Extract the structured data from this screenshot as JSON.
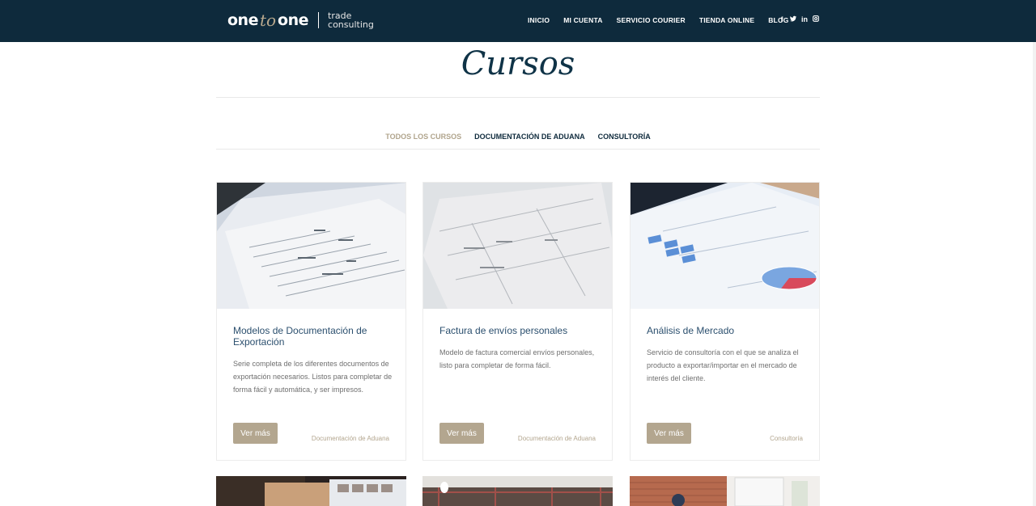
{
  "header": {
    "logo": {
      "one_left": "one",
      "to": "to",
      "one_right": "one",
      "sub_line1": "trade",
      "sub_line2": "consulting"
    },
    "nav": [
      "INICIO",
      "MI CUENTA",
      "SERVICIO COURIER",
      "TIENDA ONLINE",
      "BLOG"
    ],
    "social_icons": [
      {
        "name": "facebook-icon",
        "glyph": "f"
      },
      {
        "name": "twitter-icon",
        "glyph": "🐦"
      },
      {
        "name": "linkedin-icon",
        "glyph": "in"
      },
      {
        "name": "instagram-icon",
        "glyph": "◘"
      }
    ]
  },
  "page": {
    "title": "Cursos",
    "filters": [
      "TODOS LOS CURSOS",
      "DOCUMENTACIÓN DE ADUANA",
      "CONSULTORÍA"
    ],
    "active_filter": "TODOS LOS CURSOS"
  },
  "cards": [
    {
      "title": "Modelos de Documentación de Exportación",
      "description": "Serie completa de los diferentes documentos de exportación necesarios. Listos para completar de forma fácil y automática, y ser impresos.",
      "button": "Ver más",
      "category": "Documentación de Aduana"
    },
    {
      "title": "Factura de envíos personales",
      "description": "Modelo de factura comercial envíos personales, listo para completar de forma fácil.",
      "button": "Ver más",
      "category": "Documentación de Aduana"
    },
    {
      "title": "Análisis de Mercado",
      "description": "Servicio de consultoría con el que se analiza el producto a exportar/importar en el mercado de interés del cliente.",
      "button": "Ver más",
      "category": "Consultoría"
    }
  ],
  "colors": {
    "header_bg": "#0e2a3c",
    "accent": "#b3a68f",
    "title_blue": "#2b4f6e"
  }
}
